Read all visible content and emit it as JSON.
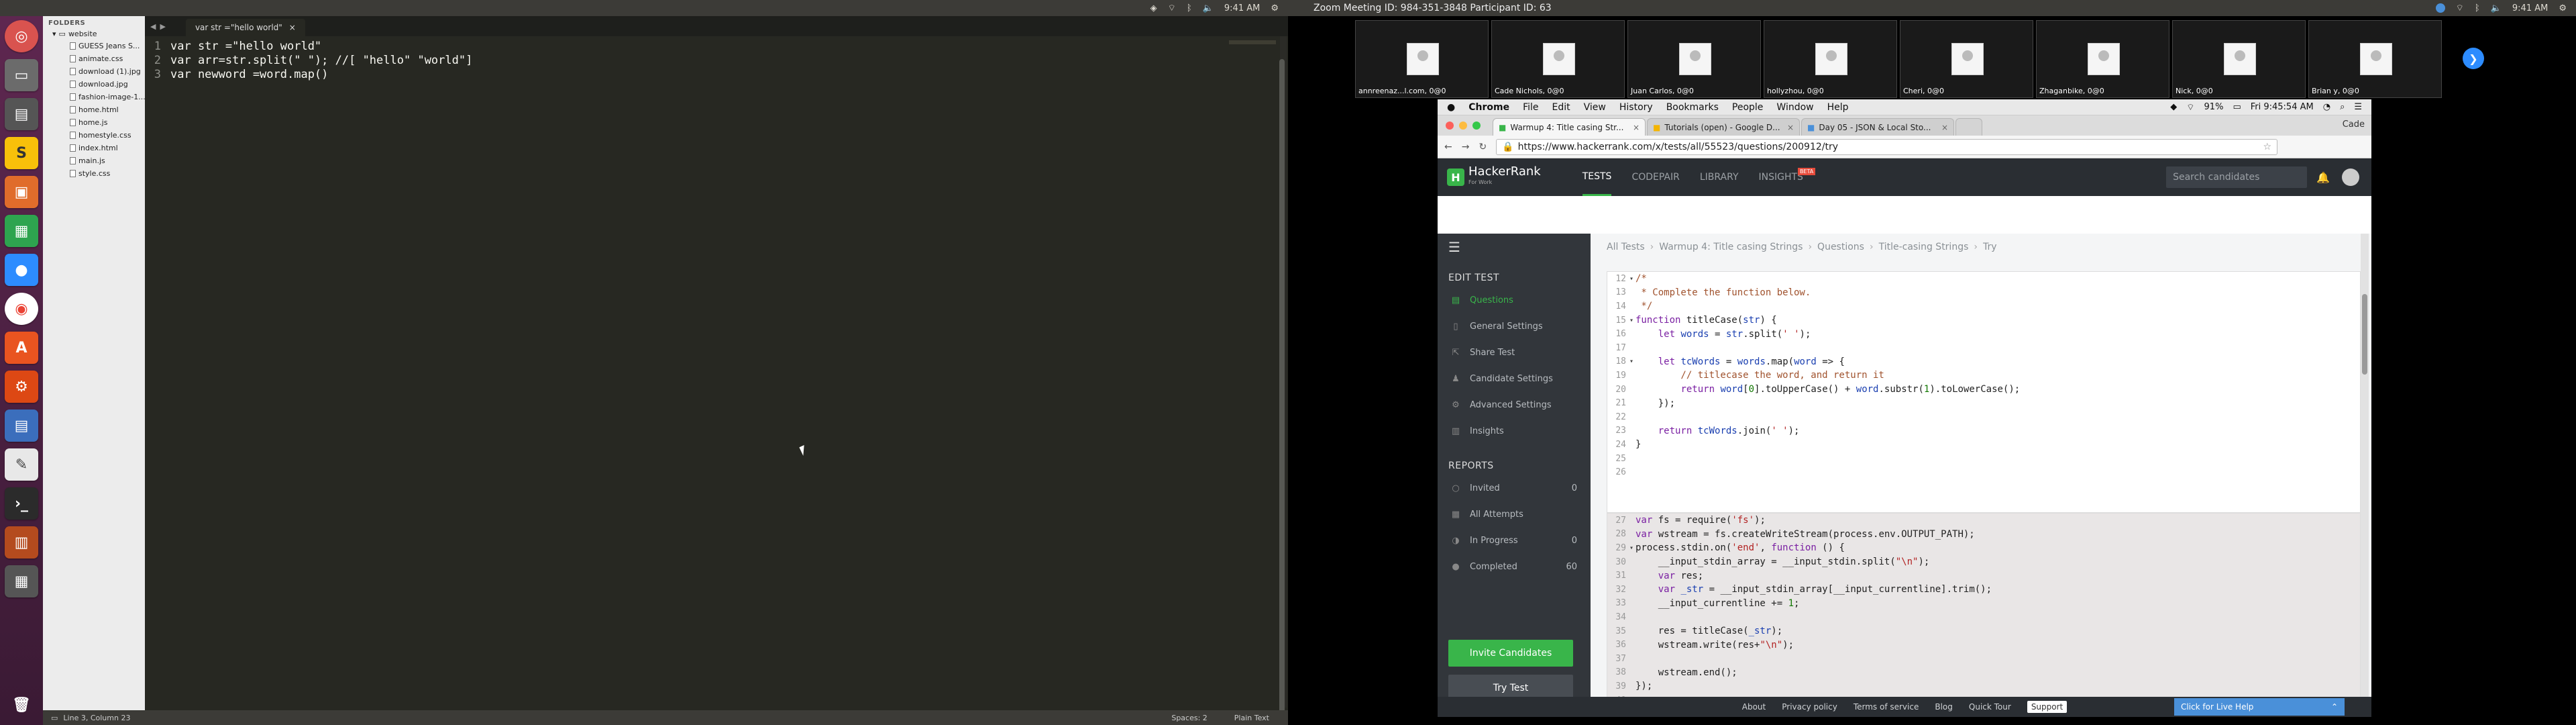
{
  "left_panel": {
    "time": "9:41 AM"
  },
  "sidebar": {
    "header": "FOLDERS",
    "folder": "website",
    "files": [
      "GUESS Jeans S...",
      "animate.css",
      "download (1).jpg",
      "download.jpg",
      "fashion-image-1...",
      "home.html",
      "home.js",
      "homestyle.css",
      "index.html",
      "main.js",
      "style.css"
    ]
  },
  "editor": {
    "tab": "var str =\"hello world\"",
    "lines": [
      {
        "num": "1",
        "text": "var str =\"hello world\""
      },
      {
        "num": "2",
        "text": "var arr=str.split(\" \"); //[ \"hello\" \"world\"]"
      },
      {
        "num": "3",
        "text": "var newword =word.map()"
      }
    ]
  },
  "status_bar": {
    "position": "Line 3, Column 23",
    "spaces": "Spaces: 2",
    "syntax": "Plain Text"
  },
  "right_panel": {
    "zoom_title": "Zoom Meeting ID: 984-351-3848  Participant ID: 63",
    "time": "9:41 AM"
  },
  "zoom": {
    "participants": [
      "annreenaz...l.com, 0@0",
      "Cade Nichols, 0@0",
      "Juan Carlos, 0@0",
      "hollyzhou, 0@0",
      "Cheri, 0@0",
      "Zhaganbike, 0@0",
      "Nick, 0@0",
      "Brian y, 0@0"
    ]
  },
  "mac_menu": {
    "app": "Chrome",
    "items": [
      "File",
      "Edit",
      "View",
      "History",
      "Bookmarks",
      "People",
      "Window",
      "Help"
    ],
    "battery": "91%",
    "clock": "Fri 9:45:54 AM",
    "user": "Cade"
  },
  "chrome": {
    "tabs": [
      {
        "label": "Warmup 4: Title casing Str..."
      },
      {
        "label": "Tutorials (open) - Google D..."
      },
      {
        "label": "Day 05 - JSON & Local Sto..."
      }
    ],
    "url": "https://www.hackerrank.com/x/tests/all/55523/questions/200912/try"
  },
  "hackerrank": {
    "logo": "HackerRank",
    "logo_sub": "For Work",
    "nav": [
      "TESTS",
      "CODEPAIR",
      "LIBRARY",
      "INSIGHTS"
    ],
    "beta": "BETA",
    "search_placeholder": "Search candidates",
    "breadcrumbs": [
      "All Tests",
      "Warmup 4: Title casing Strings",
      "Questions",
      "Title-casing Strings",
      "Try"
    ],
    "sidebar": {
      "edit_test": "EDIT TEST",
      "items": [
        "Questions",
        "General Settings",
        "Share Test",
        "Candidate Settings",
        "Advanced Settings",
        "Insights"
      ],
      "reports": "REPORTS",
      "report_items": [
        {
          "label": "Invited",
          "count": "0"
        },
        {
          "label": "All Attempts",
          "count": ""
        },
        {
          "label": "In Progress",
          "count": "0"
        },
        {
          "label": "Completed",
          "count": "60"
        }
      ],
      "invite": "Invite Candidates",
      "try": "Try Test"
    },
    "footer": [
      "About",
      "Privacy policy",
      "Terms of service",
      "Blog",
      "Quick Tour"
    ],
    "support": "Support",
    "live_help": "Click for Live Help"
  }
}
